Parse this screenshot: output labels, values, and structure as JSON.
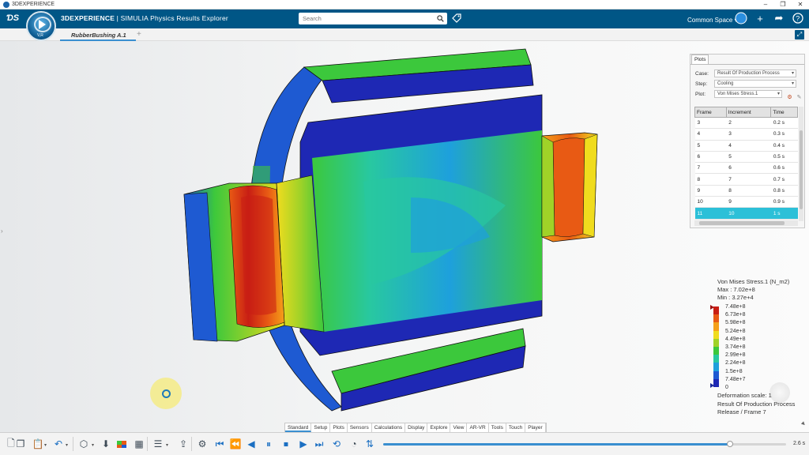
{
  "window": {
    "title": "3DEXPERIENCE"
  },
  "topbar": {
    "app_brand": "3DEXPERIENCE",
    "app_name": "| SIMULIA Physics Results Explorer",
    "search_placeholder": "Search",
    "space_label": "Common Space",
    "compass_label": "V,R"
  },
  "tabs": {
    "document": "RubberBushing A.1",
    "add": "+"
  },
  "plots_panel": {
    "tab_label": "Plots",
    "case_label": "Case:",
    "case_value": "Result Of Production Process",
    "step_label": "Step:",
    "step_value": "Cooling",
    "plot_label": "Plot:",
    "plot_value": "Von Mises Stress.1",
    "columns": [
      "Frame",
      "Increment",
      "Time"
    ],
    "rows": [
      [
        "3",
        "2",
        "0.2 s"
      ],
      [
        "4",
        "3",
        "0.3 s"
      ],
      [
        "5",
        "4",
        "0.4 s"
      ],
      [
        "6",
        "5",
        "0.5 s"
      ],
      [
        "7",
        "6",
        "0.6 s"
      ],
      [
        "8",
        "7",
        "0.7 s"
      ],
      [
        "9",
        "8",
        "0.8 s"
      ],
      [
        "10",
        "9",
        "0.9 s"
      ],
      [
        "11",
        "10",
        "1 s"
      ]
    ],
    "selected_row": 8
  },
  "legend": {
    "title": "Von Mises Stress.1 (N_m2)",
    "max": "Max : 7.02e+8",
    "min": "Min : 3.27e+4",
    "labels": [
      "7.48e+8",
      "6.73e+8",
      "5.98e+8",
      "5.24e+8",
      "4.49e+8",
      "3.74e+8",
      "2.99e+8",
      "2.24e+8",
      "1.5e+8",
      "7.48e+7",
      "0"
    ],
    "colors": [
      "#c81e14",
      "#e85a14",
      "#f5a019",
      "#f0dc1e",
      "#a0d228",
      "#3cc83c",
      "#28c8a0",
      "#1ea0dc",
      "#1e5ad2",
      "#1e28b4"
    ]
  },
  "deformation": {
    "scale": "Deformation scale: 1",
    "case": "Result Of Production Process",
    "frame": "Release / Frame 7"
  },
  "action_tabs": [
    "Standard",
    "Setup",
    "Plots",
    "Sensors",
    "Calculations",
    "Display",
    "Explore",
    "View",
    "AR-VR",
    "Tools",
    "Touch",
    "Player"
  ],
  "active_action_tab": "Standard",
  "player": {
    "time": "2.6 s",
    "progress": 0.86
  }
}
